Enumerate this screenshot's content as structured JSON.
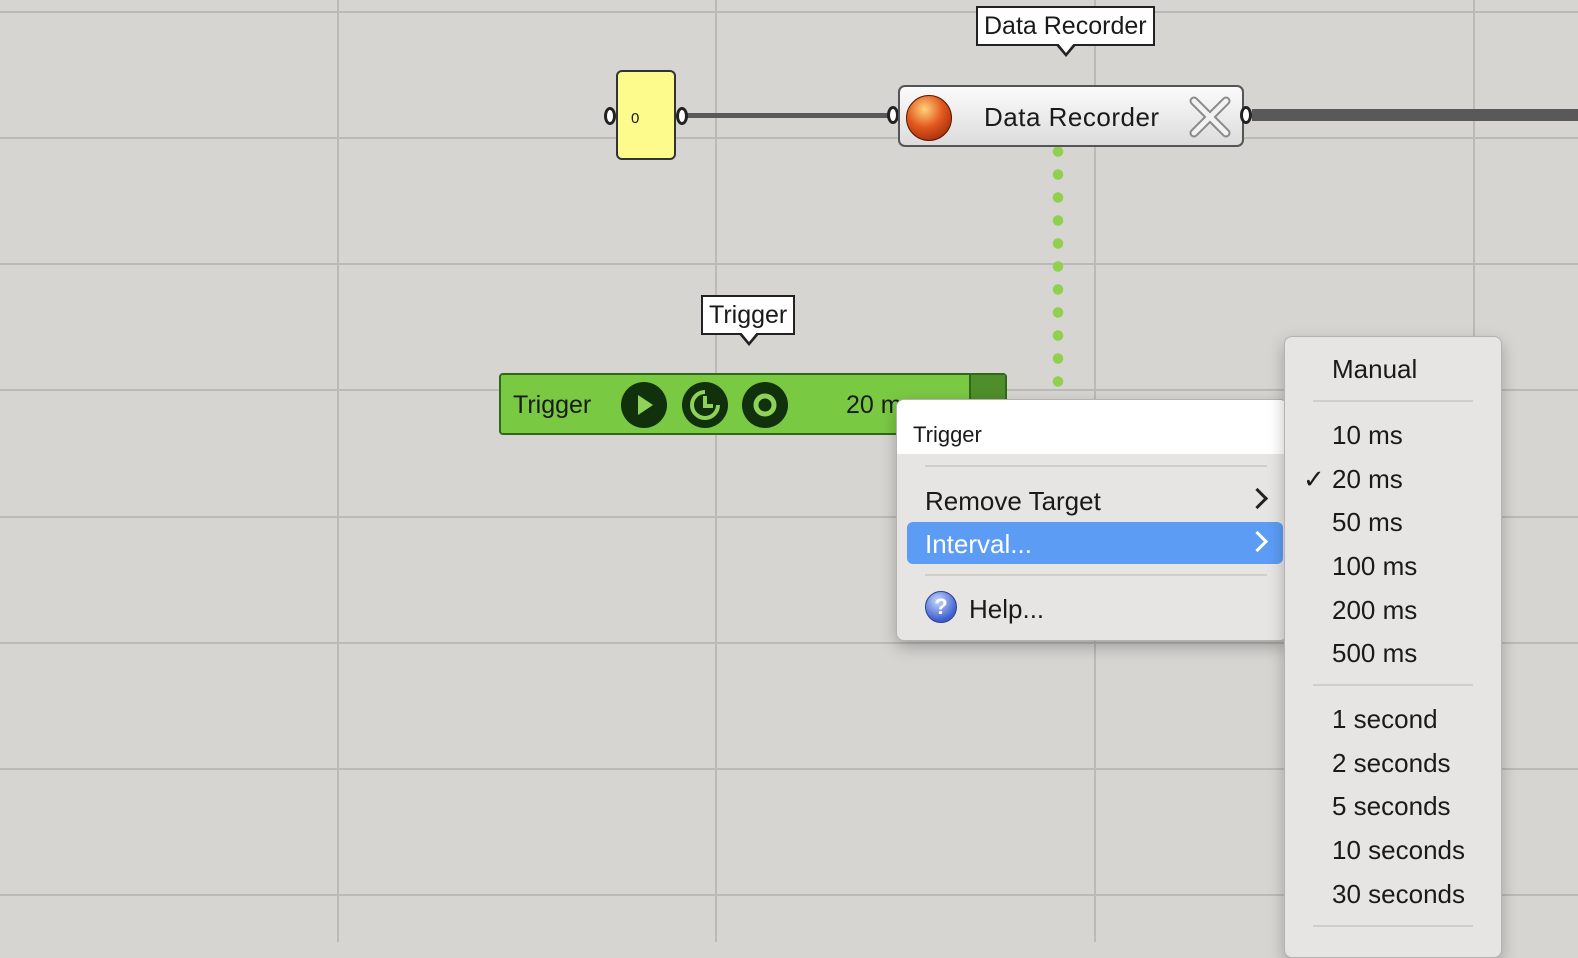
{
  "canvas": {
    "number_node": {
      "value": "0"
    },
    "data_recorder": {
      "tooltip": "Data Recorder",
      "label": "Data Recorder"
    },
    "trigger": {
      "tooltip": "Trigger",
      "label": "Trigger",
      "interval_display": "20 m"
    }
  },
  "context_menu": {
    "header": "Trigger",
    "items": [
      {
        "label": "Remove Target",
        "has_submenu": true,
        "highlighted": false
      },
      {
        "label": "Interval...",
        "has_submenu": true,
        "highlighted": true
      },
      {
        "label": "Help...",
        "icon": "help-icon",
        "has_submenu": false,
        "highlighted": false
      }
    ]
  },
  "interval_submenu": {
    "options": [
      {
        "label": "Manual"
      },
      {
        "label": "10 ms"
      },
      {
        "label": "20 ms",
        "checked": true
      },
      {
        "label": "50 ms"
      },
      {
        "label": "100 ms"
      },
      {
        "label": "200 ms"
      },
      {
        "label": "500 ms"
      },
      {
        "label": "1 second"
      },
      {
        "label": "2 seconds"
      },
      {
        "label": "5 seconds"
      },
      {
        "label": "10 seconds"
      },
      {
        "label": "30 seconds"
      }
    ],
    "check_mark": "✓"
  },
  "colors": {
    "canvas_bg": "#d7d5d1",
    "trigger_green": "#7ac943",
    "highlight_blue": "#5c9cf5",
    "number_yellow": "#fdfb8c",
    "wire_dotted": "#8fd14f"
  }
}
